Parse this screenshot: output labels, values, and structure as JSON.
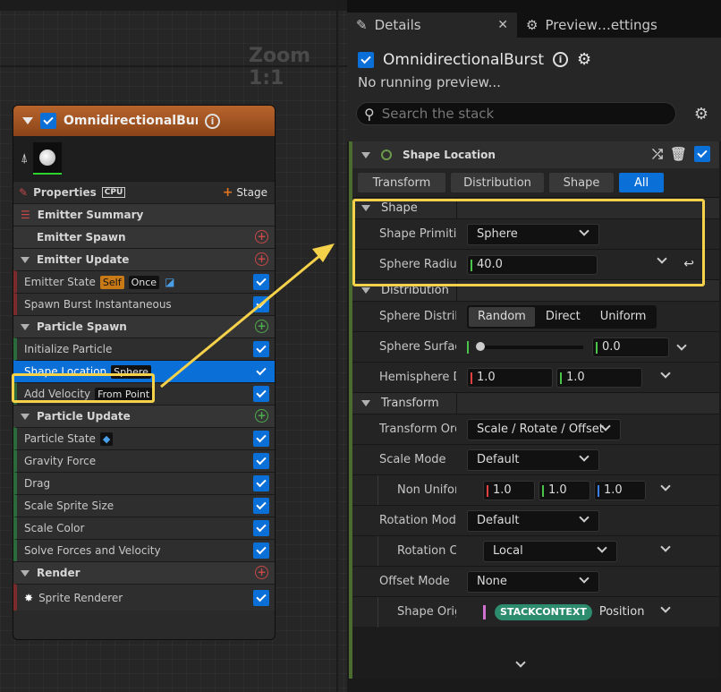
{
  "graph": {
    "zoom_label": "Zoom 1:1",
    "node": {
      "title": "OmnidirectionalBurst",
      "properties_label": "Properties",
      "cpu_label": "CPU",
      "stage_label": "Stage",
      "emitter_summary": "Emitter Summary",
      "sections": {
        "emitter_spawn": "Emitter Spawn",
        "emitter_update": "Emitter Update",
        "particle_spawn": "Particle Spawn",
        "particle_update": "Particle Update",
        "render": "Render"
      },
      "items": {
        "emitter_state": "Emitter State",
        "emitter_state_tag1": "Self",
        "emitter_state_tag2": "Once",
        "spawn_burst": "Spawn Burst Instantaneous",
        "initialize_particle": "Initialize Particle",
        "shape_location": "Shape Location",
        "shape_location_tag": "Sphere",
        "add_velocity": "Add Velocity",
        "add_velocity_tag": "From Point",
        "particle_state": "Particle State",
        "gravity_force": "Gravity Force",
        "drag": "Drag",
        "scale_sprite_size": "Scale Sprite Size",
        "scale_color": "Scale Color",
        "solve_forces": "Solve Forces and Velocity",
        "sprite_renderer": "Sprite Renderer"
      }
    }
  },
  "details": {
    "tabs": {
      "details": "Details",
      "preview": "Preview…ettings"
    },
    "title": "OmnidirectionalBurst",
    "no_preview": "No running preview...",
    "search_placeholder": "Search the stack",
    "module_title": "Shape Location",
    "filters": [
      "Transform",
      "Distribution",
      "Shape",
      "All"
    ],
    "categories": {
      "shape": "Shape",
      "distribution": "Distribution",
      "transform": "Transform"
    },
    "props": {
      "shape_primitive": {
        "label": "Shape Primitive",
        "value": "Sphere"
      },
      "sphere_radius": {
        "label": "Sphere Radius",
        "value": "40.0"
      },
      "sphere_distribution": {
        "label": "Sphere Distribution",
        "options": [
          "Random",
          "Direct",
          "Uniform"
        ],
        "selected": "Random"
      },
      "sphere_surface": {
        "label": "Sphere Surface",
        "value": "0.0"
      },
      "hemisphere": {
        "label": "Hemisphere Distribution",
        "x": "1.0",
        "y": "1.0"
      },
      "transform_order": {
        "label": "Transform Order",
        "value": "Scale / Rotate / Offset"
      },
      "scale_mode": {
        "label": "Scale Mode",
        "value": "Default"
      },
      "non_uniform": {
        "label": "Non Uniform Scale",
        "x": "1.0",
        "y": "1.0",
        "z": "1.0"
      },
      "rotation_mode": {
        "label": "Rotation Mode",
        "value": "Default"
      },
      "rotation_coord": {
        "label": "Rotation Coordinate Space",
        "value": "Local"
      },
      "offset_mode": {
        "label": "Offset Mode",
        "value": "None"
      },
      "shape_origin": {
        "label": "Shape Origin",
        "pill": "STACKCONTEXT",
        "value": "Position"
      }
    }
  },
  "colors": {
    "accent": "#0a6fd6",
    "highlight": "#f5d24a",
    "node_header": "#b8642c"
  }
}
